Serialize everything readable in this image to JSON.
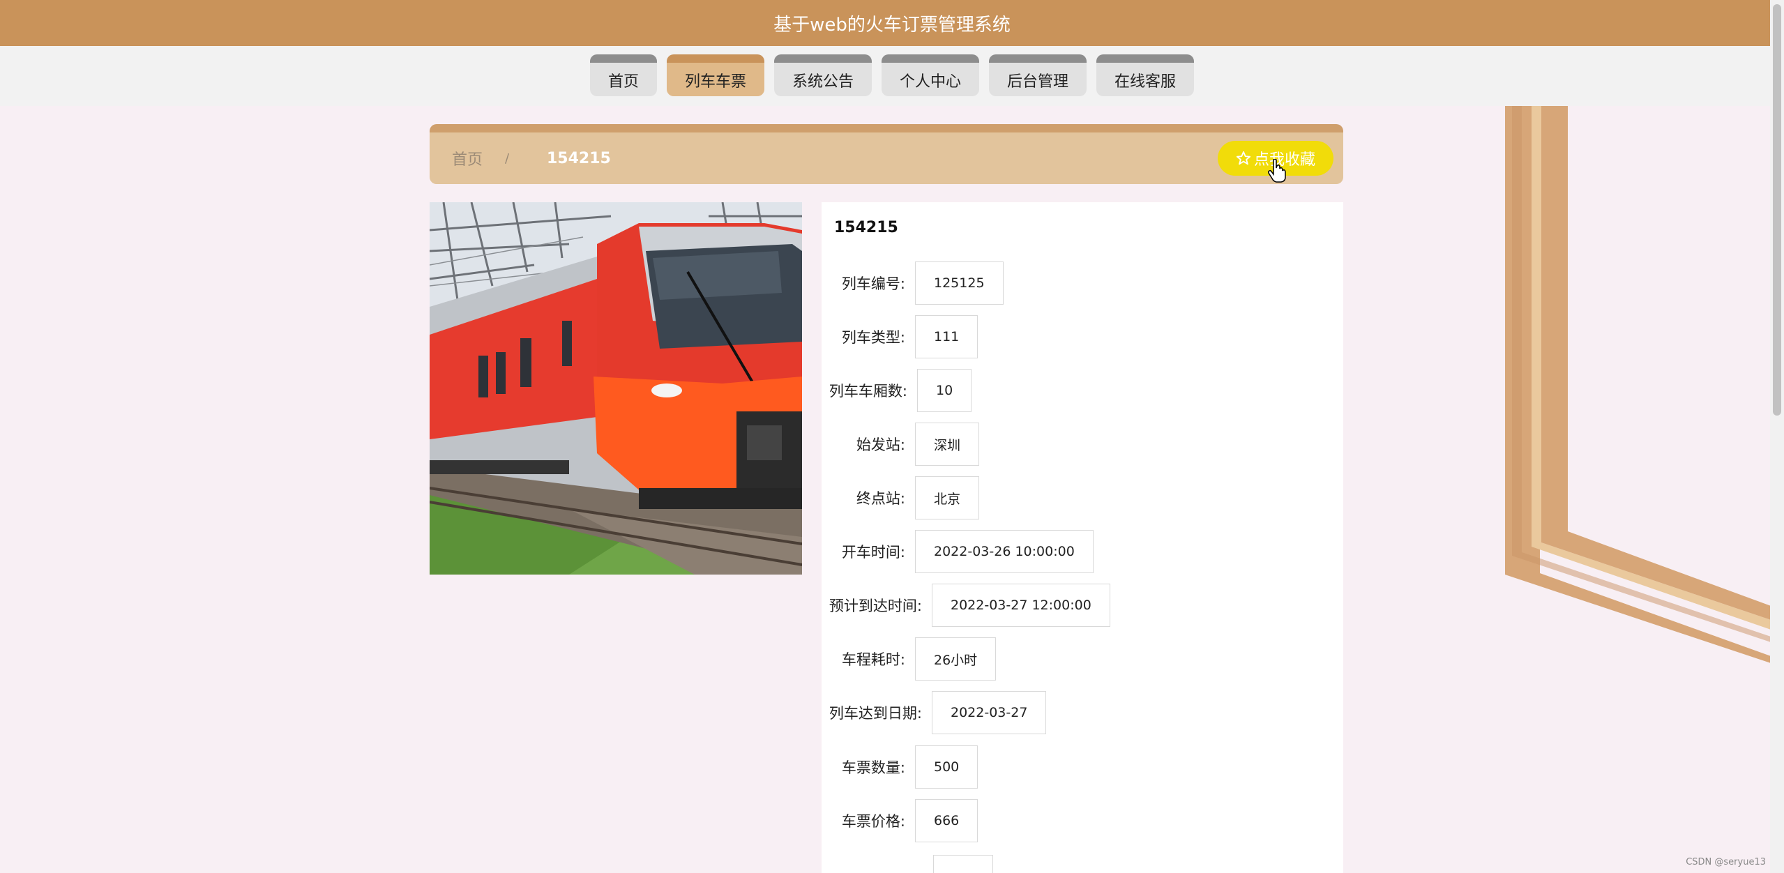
{
  "header": {
    "title": "基于web的火车订票管理系统"
  },
  "nav": {
    "tabs": [
      {
        "label": "首页",
        "active": false
      },
      {
        "label": "列车车票",
        "active": true
      },
      {
        "label": "系统公告",
        "active": false
      },
      {
        "label": "个人中心",
        "active": false
      },
      {
        "label": "后台管理",
        "active": false
      },
      {
        "label": "在线客服",
        "active": false
      }
    ]
  },
  "breadcrumb": {
    "home": "首页",
    "separator": "/",
    "current": "154215"
  },
  "favorite_button": {
    "icon": "star-outline-icon",
    "label": "点我收藏"
  },
  "detail": {
    "title": "154215",
    "fields": [
      {
        "label": "列车编号:",
        "value": "125125"
      },
      {
        "label": "列车类型:",
        "value": "111"
      },
      {
        "label": "列车车厢数:",
        "value": "10"
      },
      {
        "label": "始发站:",
        "value": "深圳"
      },
      {
        "label": "终点站:",
        "value": "北京"
      },
      {
        "label": "开车时间:",
        "value": "2022-03-26 10:00:00"
      },
      {
        "label": "预计到达时间:",
        "value": "2022-03-27 12:00:00"
      },
      {
        "label": "车程耗时:",
        "value": "26小时"
      },
      {
        "label": "列车达到日期:",
        "value": "2022-03-27"
      },
      {
        "label": "车票数量:",
        "value": "500"
      },
      {
        "label": "车票价格:",
        "value": "666"
      }
    ]
  },
  "watermark": "CSDN @seryue13",
  "colors": {
    "header_bg": "#c9935a",
    "active_tab": "#e0b989",
    "favorite_btn": "#f1dc0a",
    "page_bg": "#f8eff4"
  }
}
